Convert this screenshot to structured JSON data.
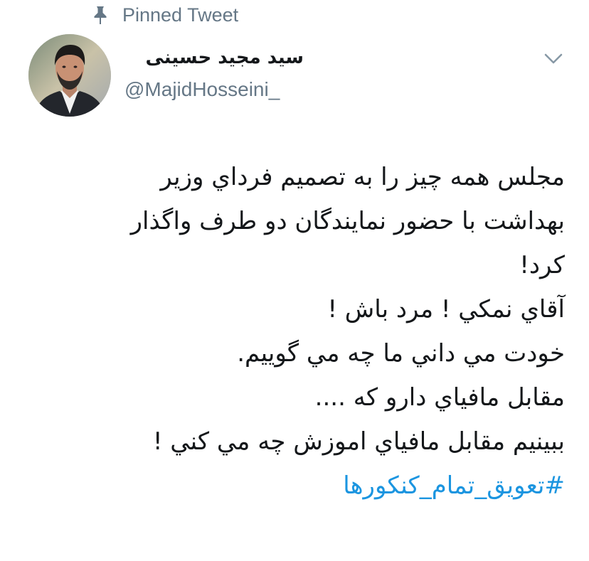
{
  "pinned": {
    "label": "Pinned Tweet",
    "icon": "pin-icon"
  },
  "author": {
    "display_name": "سید مجید حسینی",
    "handle": "@MajidHosseini_",
    "avatar_icon": "avatar"
  },
  "menu": {
    "icon": "chevron-down-icon"
  },
  "tweet": {
    "lines": [
      "مجلس همه چيز را به تصميم فرداي وزير",
      "بهداشت با حضور نمايندگان دو طرف واگذار",
      "کرد!",
      "آقاي نمکي ! مرد باش !",
      "خودت مي داني ما چه مي گوييم.",
      "مقابل مافياي دارو که ....",
      "ببينيم مقابل مافياي اموزش چه مي کني !"
    ],
    "hashtag": "#تعويق_تمام_کنکورها"
  },
  "colors": {
    "link": "#1b95e0",
    "secondary_text": "#657786",
    "primary_text": "#14171a"
  }
}
